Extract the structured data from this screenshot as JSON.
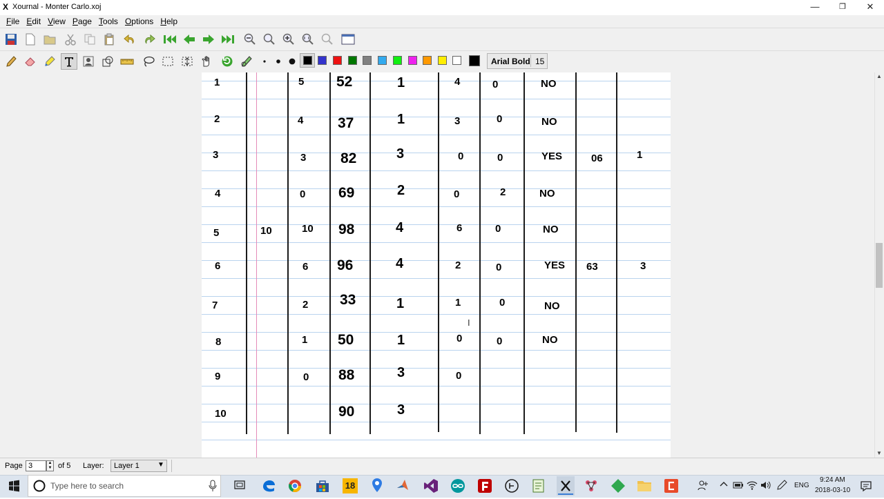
{
  "window": {
    "title": "Xournal - Monter Carlo.xoj",
    "app_icon_glyph": "X",
    "minimize_glyph": "—",
    "restore_glyph": "❐",
    "close_glyph": "✕"
  },
  "menu": [
    {
      "mnemonic": "F",
      "rest": "ile"
    },
    {
      "mnemonic": "E",
      "rest": "dit"
    },
    {
      "mnemonic": "V",
      "rest": "iew"
    },
    {
      "mnemonic": "P",
      "rest": "age"
    },
    {
      "mnemonic": "T",
      "rest": "ools"
    },
    {
      "mnemonic": "O",
      "rest": "ptions"
    },
    {
      "mnemonic": "H",
      "rest": "elp"
    }
  ],
  "toolbar": {
    "font_name": "Arial Bold",
    "font_size": "15",
    "colors": [
      "#000000",
      "#3333cc",
      "#ee1111",
      "#007700",
      "#808080",
      "#33aaee",
      "#11ee11",
      "#ee22ee",
      "#ff9900",
      "#ffee00",
      "#ffffff"
    ],
    "current_color": "#000000",
    "selected_color_index": 0
  },
  "table": {
    "rows": [
      {
        "idx": "1",
        "c1": "",
        "c2": "5",
        "c3": "52",
        "c4": "1",
        "c5": "4",
        "c6": "0",
        "c7": "NO",
        "c8": "",
        "c9": ""
      },
      {
        "idx": "2",
        "c1": "",
        "c2": "4",
        "c3": "37",
        "c4": "1",
        "c5": "3",
        "c6": "0",
        "c7": "NO",
        "c8": "",
        "c9": ""
      },
      {
        "idx": "3",
        "c1": "",
        "c2": "3",
        "c3": "82",
        "c4": "3",
        "c5": "0",
        "c6": "0",
        "c7": "YES",
        "c8": "06",
        "c9": "1"
      },
      {
        "idx": "4",
        "c1": "",
        "c2": "0",
        "c3": "69",
        "c4": "2",
        "c5": "0",
        "c6": "2",
        "c7": "NO",
        "c8": "",
        "c9": ""
      },
      {
        "idx": "5",
        "c1": "10",
        "c2": "10",
        "c3": "98",
        "c4": "4",
        "c5": "6",
        "c6": "0",
        "c7": "NO",
        "c8": "",
        "c9": ""
      },
      {
        "idx": "6",
        "c1": "",
        "c2": "6",
        "c3": "96",
        "c4": "4",
        "c5": "2",
        "c6": "0",
        "c7": "YES",
        "c8": "63",
        "c9": "3"
      },
      {
        "idx": "7",
        "c1": "",
        "c2": "2",
        "c3": "33",
        "c4": "1",
        "c5": "1",
        "c6": "0",
        "c7": "NO",
        "c8": "",
        "c9": ""
      },
      {
        "idx": "8",
        "c1": "",
        "c2": "1",
        "c3": "50",
        "c4": "1",
        "c5": "0",
        "c6": "0",
        "c7": "NO",
        "c8": "",
        "c9": ""
      },
      {
        "idx": "9",
        "c1": "",
        "c2": "0",
        "c3": "88",
        "c4": "3",
        "c5": "0",
        "c6": "",
        "c7": "",
        "c8": "",
        "c9": ""
      },
      {
        "idx": "10",
        "c1": "",
        "c2": "",
        "c3": "90",
        "c4": "3",
        "c5": "",
        "c6": "",
        "c7": "",
        "c8": "",
        "c9": ""
      }
    ]
  },
  "cursor_glyph": "I",
  "scroll": {
    "up_glyph": "▲",
    "down_glyph": "▼"
  },
  "status": {
    "page_label": "Page",
    "page_value": "3",
    "of_label": "of 5",
    "layer_label": "Layer:",
    "layer_value": "Layer 1",
    "layer_arrow": "▼",
    "spin_up": "▲",
    "spin_down": "▼"
  },
  "taskbar": {
    "search_placeholder": "Type here to search",
    "time": "9:24 AM",
    "date": "2018-03-10",
    "language": "ENG",
    "badge_18": "18"
  }
}
